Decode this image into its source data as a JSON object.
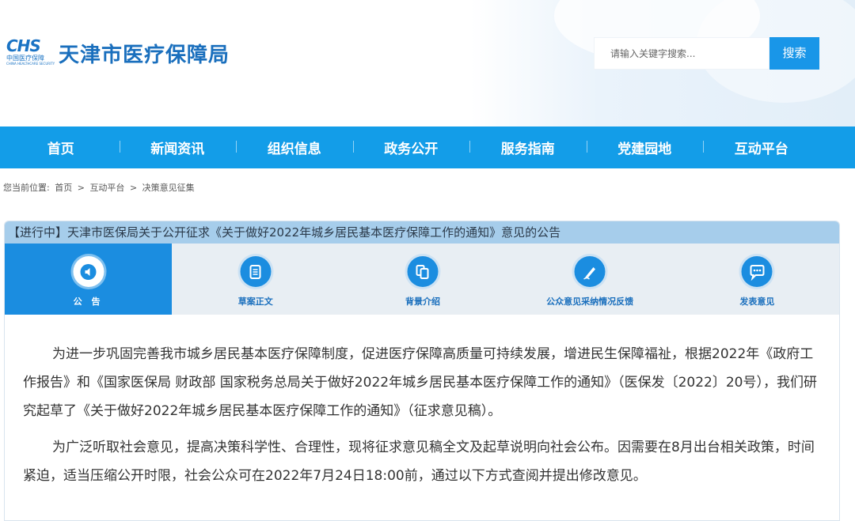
{
  "header": {
    "logo_text": "CHS",
    "logo_cn": "中国医疗保障",
    "logo_en": "CHINA HEALTHCARE SECURITY",
    "site_title": "天津市医疗保障局",
    "search_placeholder": "请输入关键字搜索...",
    "search_button": "搜索"
  },
  "nav": {
    "items": [
      "首页",
      "新闻资讯",
      "组织信息",
      "政务公开",
      "服务指南",
      "党建园地",
      "互动平台"
    ]
  },
  "breadcrumb": {
    "prefix": "您当前位置:",
    "items": [
      "首页",
      ">",
      "互动平台",
      ">",
      "决策意见征集"
    ]
  },
  "panel": {
    "title": "【进行中】天津市医保局关于公开征求《关于做好2022年城乡居民基本医疗保障工作的通知》意见的公告",
    "tabs": [
      {
        "label": "公 告",
        "icon": "speaker-icon"
      },
      {
        "label": "草案正文",
        "icon": "document-icon"
      },
      {
        "label": "背景介绍",
        "icon": "copy-icon"
      },
      {
        "label": "公众意见采纳情况反馈",
        "icon": "pen-icon"
      },
      {
        "label": "发表意见",
        "icon": "chat-icon"
      }
    ],
    "active_tab": 0,
    "paragraphs": [
      "为进一步巩固完善我市城乡居民基本医疗保障制度，促进医疗保障高质量可持续发展，增进民生保障福祉，根据2022年《政府工作报告》和《国家医保局 财政部 国家税务总局关于做好2022年城乡居民基本医疗保障工作的通知》（医保发〔2022〕20号），我们研究起草了《关于做好2022年城乡居民基本医疗保障工作的通知》（征求意见稿）。",
      "为广泛听取社会意见，提高决策科学性、合理性，现将征求意见稿全文及起草说明向社会公布。因需要在8月出台相关政策，时间紧迫，适当压缩公开时限，社会公众可在2022年7月24日18:00前，通过以下方式查阅并提出修改意见。"
    ]
  },
  "colors": {
    "nav_blue": "#139de8",
    "accent_blue": "#1b8de0",
    "title_bar": "#a6cdeb",
    "brand_blue": "#1a6fbd"
  }
}
